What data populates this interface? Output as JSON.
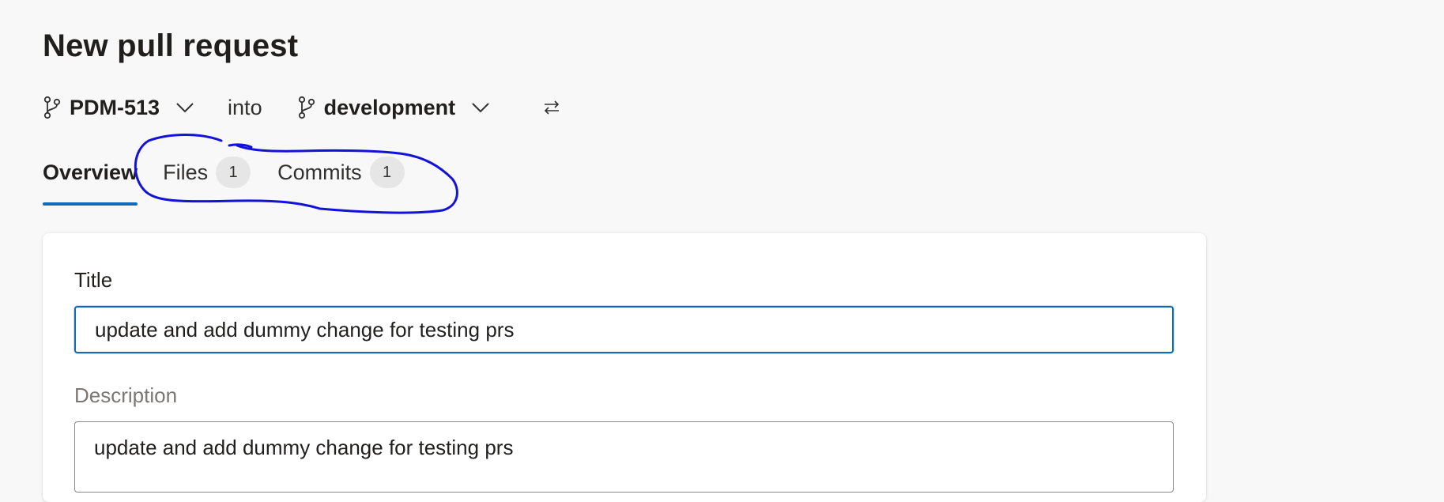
{
  "page": {
    "title": "New pull request"
  },
  "branches": {
    "source": "PDM-513",
    "into_label": "into",
    "target": "development"
  },
  "tabs": [
    {
      "label": "Overview",
      "selected": true
    },
    {
      "label": "Files",
      "count": "1"
    },
    {
      "label": "Commits",
      "count": "1"
    }
  ],
  "form": {
    "title_label": "Title",
    "title_value": "update and add dummy change for testing prs",
    "description_label": "Description",
    "description_value": "update and add dummy change for testing prs"
  },
  "colors": {
    "accent": "#0f6cbd",
    "annotation": "#1212d8",
    "background": "#f8f8f8"
  },
  "icons": {
    "source_branch": "branch-icon",
    "target_branch": "branch-icon",
    "dropdown": "chevron-down-icon",
    "swap": "swap-arrows-icon"
  }
}
